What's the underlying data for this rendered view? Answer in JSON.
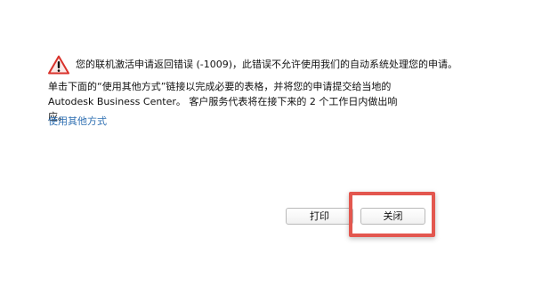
{
  "dialog": {
    "icon": "warning-triangle-icon",
    "error_message": "您的联机激活申请返回错误 (-1009)，此错误不允许使用我们的自动系统处理您的申请。",
    "instruction": "单击下面的“使用其他方式”链接以完成必要的表格，并将您的申请提交给当地的 Autodesk Business Center。 客户服务代表将在接下来的 2 个工作日内做出响应。",
    "alt_link": "使用其他方式",
    "buttons": {
      "print": "打印",
      "close": "关闭"
    }
  },
  "colors": {
    "link": "#2f6fb2",
    "warning_red": "#d9322b",
    "highlight": "#e3574f"
  }
}
